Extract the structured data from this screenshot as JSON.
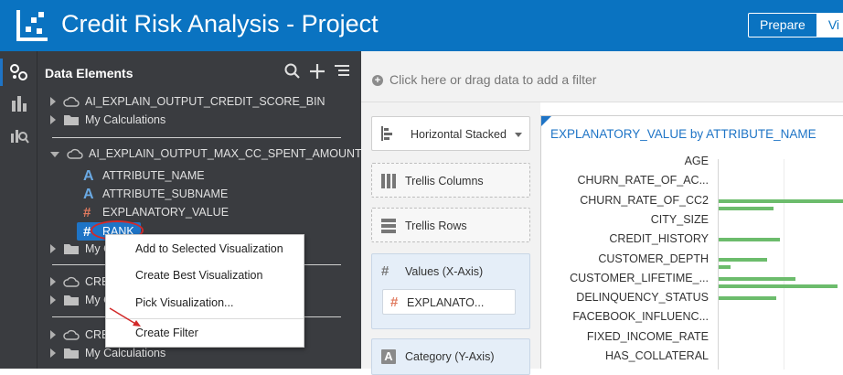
{
  "header": {
    "title": "Credit Risk Analysis - Project",
    "tabs": [
      {
        "label": "Prepare",
        "active": false
      },
      {
        "label": "Vi",
        "active": true
      }
    ]
  },
  "sidebar": {
    "icons": [
      "data-elements-icon",
      "visualizations-icon",
      "analytics-icon"
    ]
  },
  "data_panel": {
    "title": "Data Elements",
    "tools": [
      "search-icon",
      "add-icon",
      "menu-icon"
    ],
    "tree": {
      "sources": [
        {
          "label": "AI_EXPLAIN_OUTPUT_CREDIT_SCORE_BIN",
          "calc": "My Calculations"
        },
        {
          "label": "AI_EXPLAIN_OUTPUT_MAX_CC_SPENT_AMOUNT",
          "calc": "My C"
        },
        {
          "label": "CRE",
          "calc": "My C"
        },
        {
          "label": "CRE",
          "calc": "My Calculations"
        }
      ],
      "columns": [
        {
          "label": "ATTRIBUTE_NAME",
          "type": "A"
        },
        {
          "label": "ATTRIBUTE_SUBNAME",
          "type": "A"
        },
        {
          "label": "EXPLANATORY_VALUE",
          "type": "#"
        },
        {
          "label": "RANK",
          "type": "#"
        }
      ]
    }
  },
  "context_menu": {
    "items": [
      "Add to Selected Visualization",
      "Create Best Visualization",
      "Pick Visualization...",
      "Create Filter"
    ]
  },
  "filter_bar": {
    "placeholder": "Click here or drag data to add a filter"
  },
  "grammar": {
    "viz_type": "Horizontal Stacked",
    "trellis_columns": "Trellis Columns",
    "trellis_rows": "Trellis Rows",
    "values_label": "Values (X-Axis)",
    "values_pill": "EXPLANATO...",
    "category_label": "Category (Y-Axis)"
  },
  "chart_data": {
    "type": "bar",
    "orientation": "horizontal",
    "title": "EXPLANATORY_VALUE by ATTRIBUTE_NAME",
    "categories": [
      "AGE",
      "CHURN_RATE_OF_AC...",
      "CHURN_RATE_OF_CC2",
      "CITY_SIZE",
      "CREDIT_HISTORY",
      "CUSTOMER_DEPTH",
      "CUSTOMER_LIFETIME_...",
      "DELINQUENCY_STATUS",
      "FACEBOOK_INFLUENC...",
      "FIXED_INCOME_RATE",
      "HAS_COLLATERAL"
    ],
    "series": [
      {
        "values": [
          0,
          0,
          0.0195,
          0,
          0.0095,
          0.0075,
          0.012,
          0.009,
          0,
          0,
          0
        ]
      },
      {
        "values": [
          0,
          0,
          0.0085,
          0,
          0,
          0.0018,
          0.0185,
          0,
          0,
          0,
          0
        ]
      }
    ],
    "colors": {
      "bar": "#6cbc6c",
      "title": "#1e74c6"
    }
  }
}
